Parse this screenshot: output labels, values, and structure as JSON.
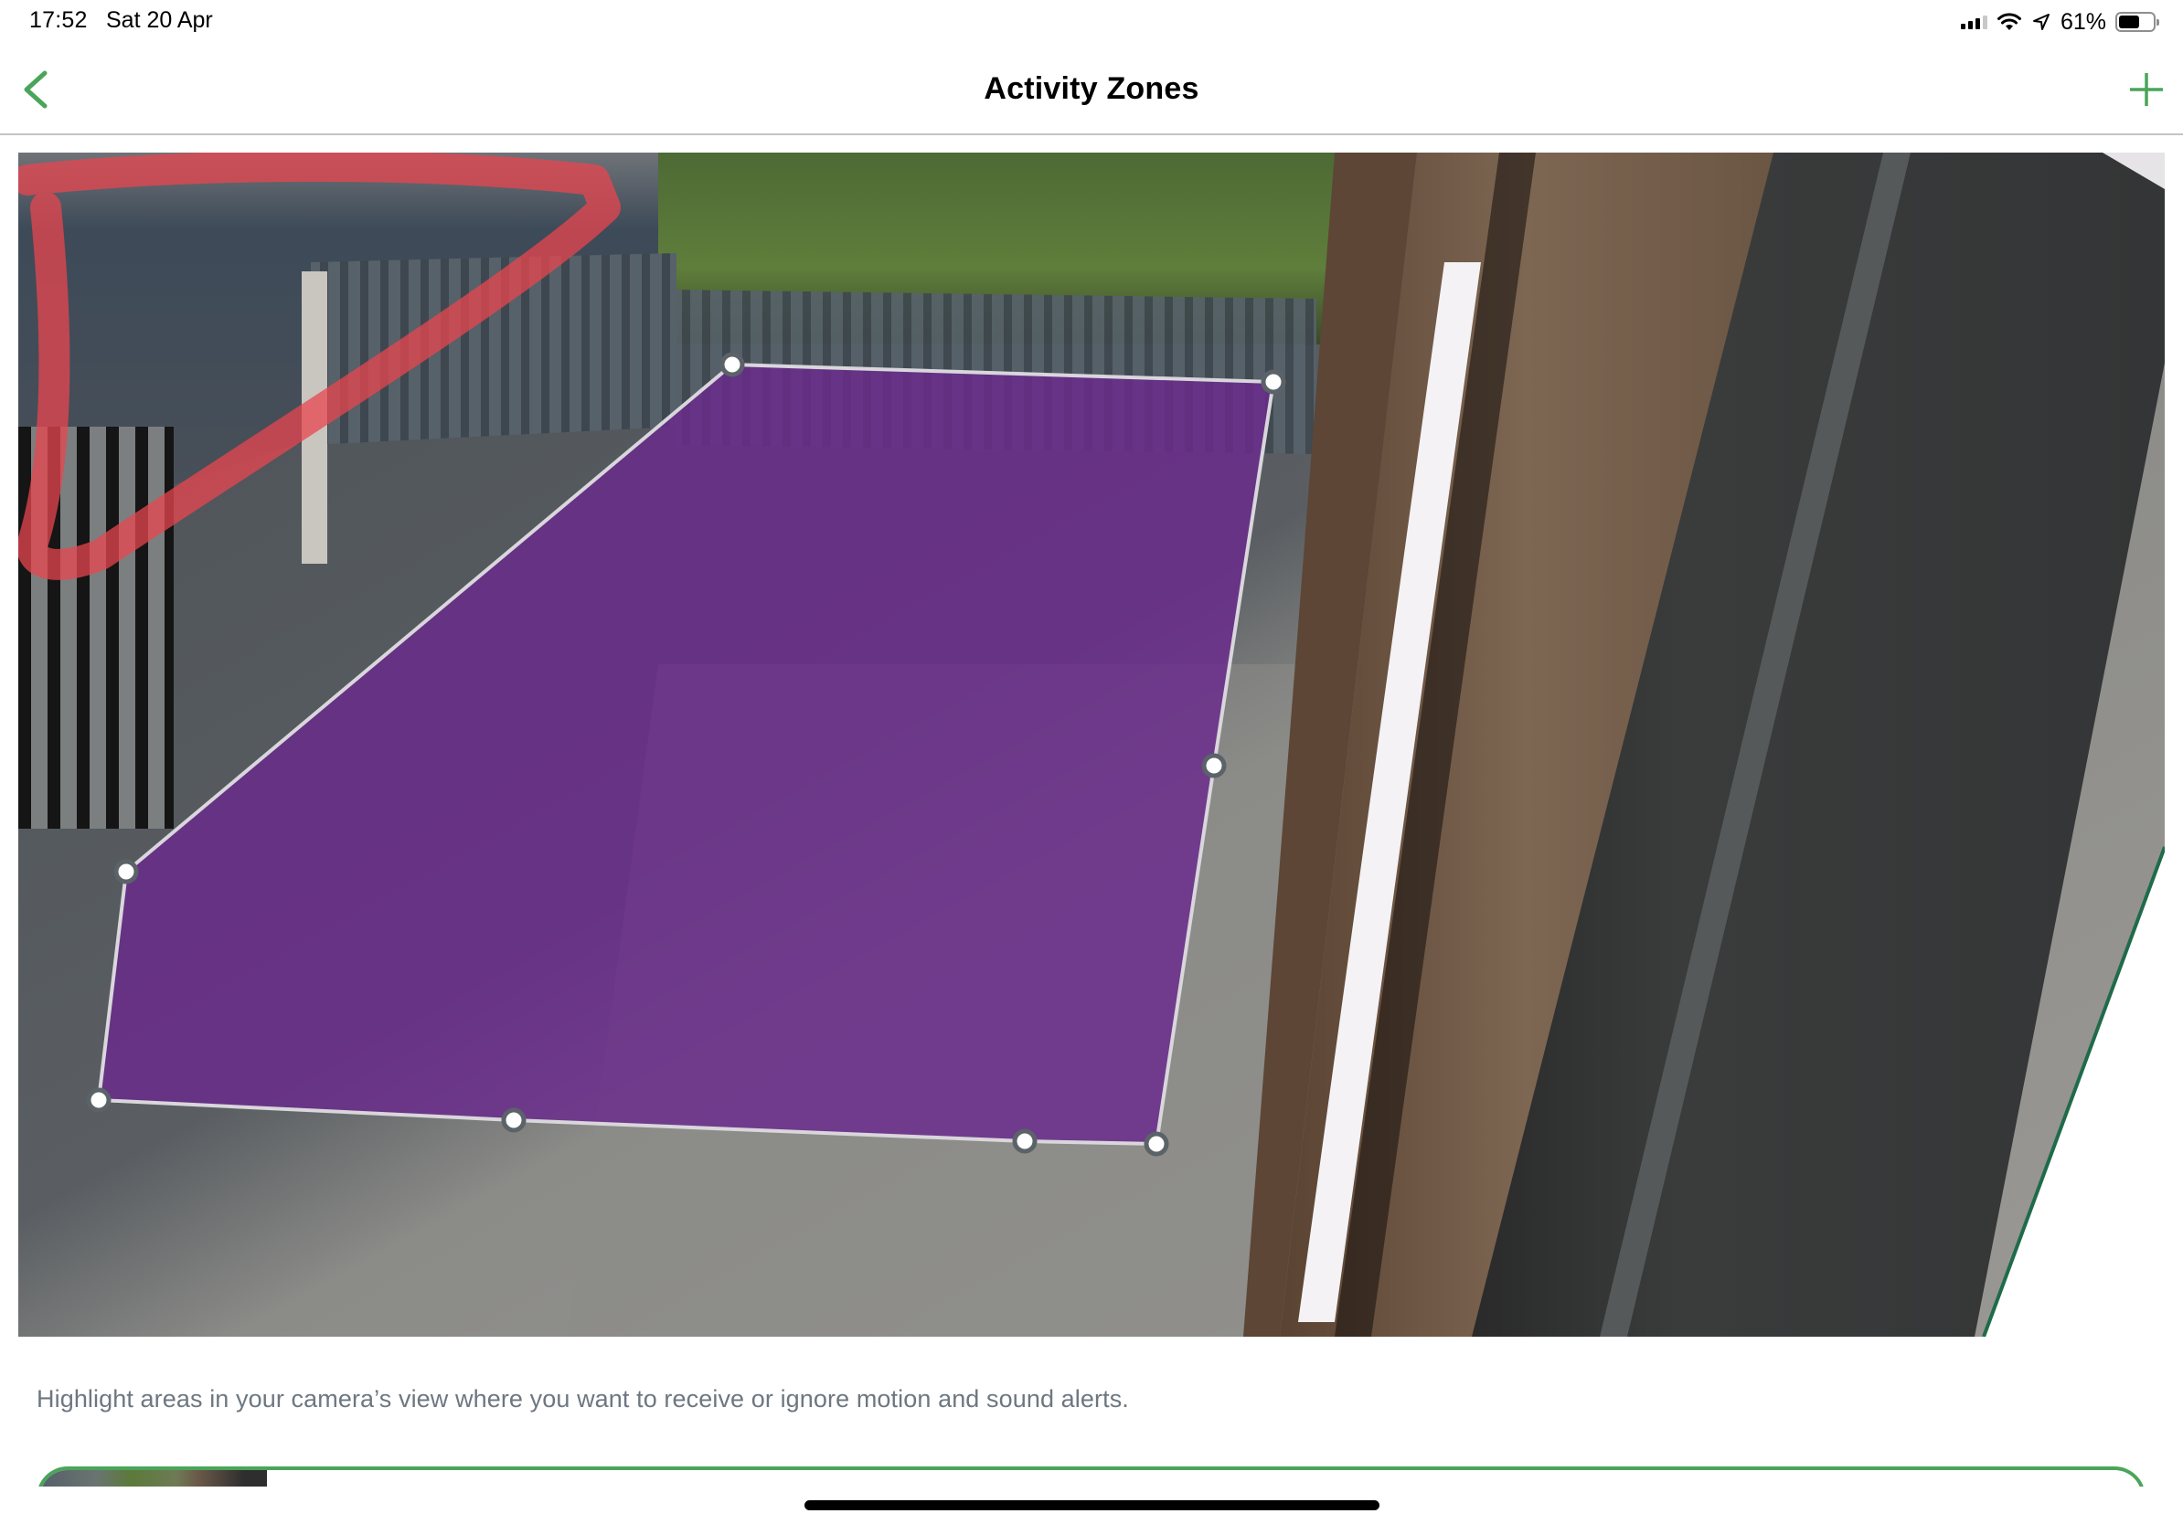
{
  "status_bar": {
    "time": "17:52",
    "date": "Sat 20 Apr",
    "battery_percent": "61%",
    "battery_level": 0.61,
    "signal_bars_active": 3,
    "signal_bars_total": 4,
    "icons": [
      "cellular-signal-icon",
      "wifi-icon",
      "location-arrow-icon",
      "battery-icon"
    ]
  },
  "nav": {
    "title": "Activity Zones",
    "back_icon": "chevron-left-icon",
    "add_icon": "plus-icon",
    "accent_color": "#4aa55a"
  },
  "camera": {
    "zone": {
      "fill_color": "#6a2a8c",
      "stroke_color": "#d9d6dc",
      "handle_count": 8
    },
    "annotation_color": "#e8454f"
  },
  "description": "Highlight areas in your camera’s view where you want to receive or ignore motion and sound alerts.",
  "zone_card": {
    "border_color": "#4aa55a"
  }
}
